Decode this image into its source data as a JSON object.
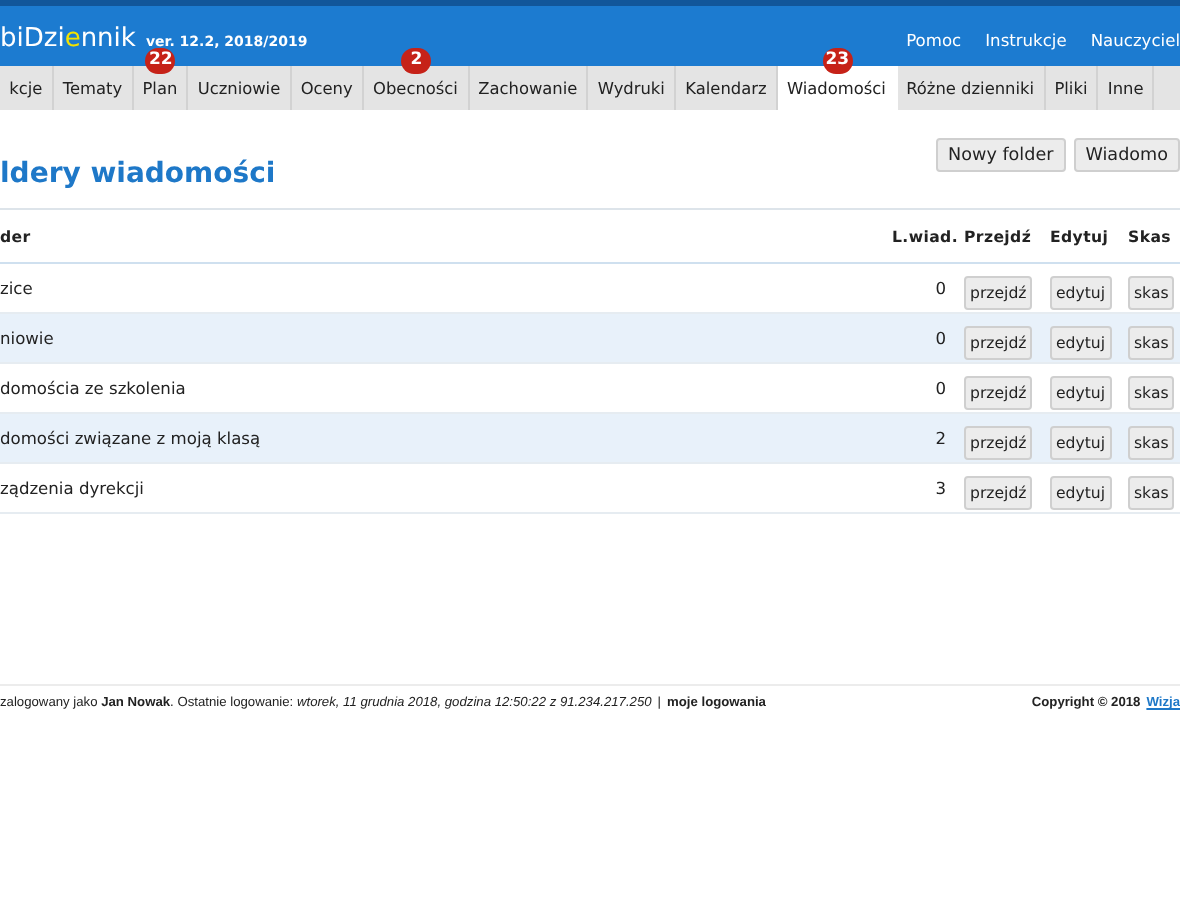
{
  "header": {
    "logo": {
      "before": "biDzi",
      "accent": "e",
      "after": "nnik"
    },
    "version": "ver. 12.2, 2018/2019",
    "links": [
      "Pomoc",
      "Instrukcje",
      "Nauczyciel"
    ]
  },
  "tabs": [
    {
      "label": "kcje",
      "selected": false
    },
    {
      "label": "Tematy",
      "selected": false
    },
    {
      "label": "Plan",
      "selected": false,
      "badge": "22"
    },
    {
      "label": "Uczniowie",
      "selected": false
    },
    {
      "label": "Oceny",
      "selected": false
    },
    {
      "label": "Obecności",
      "selected": false,
      "badge": "2"
    },
    {
      "label": "Zachowanie",
      "selected": false
    },
    {
      "label": "Wydruki",
      "selected": false
    },
    {
      "label": "Kalendarz",
      "selected": false
    },
    {
      "label": "Wiadomości",
      "selected": true,
      "badge": "23"
    },
    {
      "label": "Różne dzienniki",
      "selected": false
    },
    {
      "label": "Pliki",
      "selected": false
    },
    {
      "label": "Inne",
      "selected": false
    }
  ],
  "page": {
    "title": "ldery wiadomości",
    "buttons": [
      "Nowy folder",
      "Wiadomo"
    ]
  },
  "table": {
    "columns": [
      "der",
      "L.wiad.",
      "Przejdź",
      "Edytuj",
      "Skas"
    ],
    "rows": [
      {
        "name": "zice",
        "count": "0",
        "actions": [
          "przejdź",
          "edytuj",
          "skas"
        ]
      },
      {
        "name": "niowie",
        "count": "0",
        "actions": [
          "przejdź",
          "edytuj",
          "skas"
        ]
      },
      {
        "name": "domościa ze szkolenia",
        "count": "0",
        "actions": [
          "przejdź",
          "edytuj",
          "skas"
        ]
      },
      {
        "name": "domości związane z moją klasą",
        "count": "2",
        "actions": [
          "przejdź",
          "edytuj",
          "skas"
        ]
      },
      {
        "name": "ządzenia dyrekcji",
        "count": "3",
        "actions": [
          "przejdź",
          "edytuj",
          "skas"
        ]
      }
    ]
  },
  "footer": {
    "login_info": "zalogowany jako **Jan Nowak**. Ostatnie logowanie: *wtorek, 11 grudnia 2018, godzina 12:50:22 z 91.234.217.250*",
    "separator": "|",
    "logins_link": "moje logowania",
    "copyright": "Copyright © 2018",
    "vendor_link": "Wizja"
  }
}
